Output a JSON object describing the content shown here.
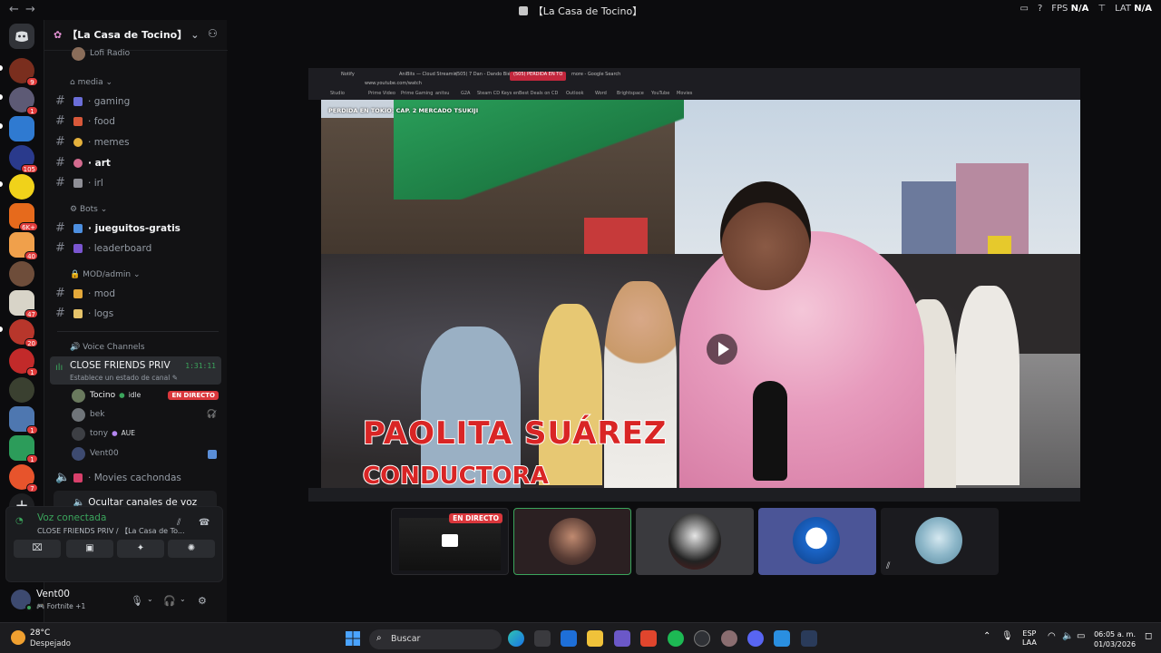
{
  "titlebar": {
    "title": "【La Casa de Tocino】",
    "back_icon": "arrow-left-icon",
    "forward_icon": "arrow-right-icon",
    "fps_label": "FPS",
    "fps_value": "N/A",
    "lat_label": "LAT",
    "lat_value": "N/A"
  },
  "server": {
    "name": "【La Casa de Tocino】",
    "top_partial_channel": "Lofi Radio",
    "categories": [
      {
        "name": "media",
        "channels": [
          "gaming",
          "food",
          "memes",
          "art",
          "irl"
        ]
      },
      {
        "name": "Bots",
        "channels": [
          "jueguitos-gratis",
          "leaderboard"
        ]
      },
      {
        "name": "MOD/admin",
        "channels": [
          "mod",
          "logs"
        ]
      }
    ],
    "unread_channels": [
      "art",
      "jueguitos-gratis"
    ]
  },
  "voice_channels": {
    "category": "Voice Channels",
    "active": {
      "name": "CLOSE FRIENDS PRIV",
      "status_placeholder": "Establece un estado de canal",
      "elapsed": "1:31:11"
    },
    "members": [
      {
        "name": "Tocino",
        "tag": "idle",
        "live": "EN DIRECTO"
      },
      {
        "name": "bek",
        "tag": "",
        "live": ""
      },
      {
        "name": "tony",
        "tag": "AUE",
        "live": ""
      },
      {
        "name": "Vent00",
        "tag": "",
        "live": ""
      }
    ],
    "other_channel": "Movies cachondas",
    "hide_button": "Ocultar canales de voz"
  },
  "voice_panel": {
    "status": "Voz conectada",
    "location": "CLOSE FRIENDS PRIV / 【La Casa de To..."
  },
  "user": {
    "name": "Vent00",
    "activity": "Fortnite +1"
  },
  "stream": {
    "overlay_title": "PERDIDA EN TOKIO: CAP. 2 MERCADO TSUKIJI",
    "lower_third_name": "PAOLITA SUÁREZ",
    "lower_third_role": "CONDUCTORA",
    "browser_tabs": [
      "Notify",
      "AniBits — Cloud Streamin",
      "(505) 7 Dan - Dando Bién",
      "(505) PERDIDA EN TO",
      "more - Google Search"
    ],
    "browser_bookmarks": [
      "Studio",
      "Prime Video",
      "Prime Gaming",
      "anitsu",
      "G2A",
      "Steam CD Keys en",
      "Best Deals on CD",
      "Outlook",
      "Word",
      "Brightspace",
      "YouTube",
      "Movies"
    ],
    "url": "www.youtube.com/watch"
  },
  "tiles": [
    {
      "label": "screen-share",
      "live": "EN DIRECTO",
      "bg": "#1a1a1e"
    },
    {
      "label": "tocino-camera",
      "live": "",
      "bg": "#2b2022"
    },
    {
      "label": "avatar-hood",
      "live": "",
      "bg": "#3a3a3e"
    },
    {
      "label": "avatar-blue",
      "live": "",
      "bg": "#4b5597"
    },
    {
      "label": "avatar-bird",
      "live": "",
      "bg": "#1b1b1f"
    }
  ],
  "taskbar": {
    "weather_temp": "28°C",
    "weather_desc": "Despejado",
    "search_placeholder": "Buscar",
    "lang_top": "ESP",
    "lang_bottom": "LAA",
    "time": "06:05 a. m.",
    "date": "01/03/2026"
  }
}
